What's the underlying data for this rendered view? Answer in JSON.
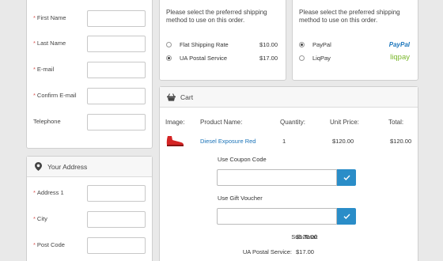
{
  "personal": {
    "fields": [
      {
        "label": "First Name",
        "required": true
      },
      {
        "label": "Last Name",
        "required": true
      },
      {
        "label": "E-mail",
        "required": true
      },
      {
        "label": "Confirm E-mail",
        "required": true
      },
      {
        "label": "Telephone",
        "required": false
      }
    ]
  },
  "address": {
    "title": "Your Address",
    "fields": [
      {
        "label": "Address 1",
        "required": true
      },
      {
        "label": "City",
        "required": true
      },
      {
        "label": "Post Code",
        "required": true
      }
    ]
  },
  "shipping": {
    "intro": "Please select the preferred shipping method to use on this order.",
    "options": [
      {
        "label": "Flat Shipping Rate",
        "price": "$10.00",
        "selected": false
      },
      {
        "label": "UA Postal Service",
        "price": "$17.00",
        "selected": true
      }
    ]
  },
  "payment": {
    "intro": "Please select the preferred shipping method to use on this order.",
    "options": [
      {
        "label": "PayPal",
        "logo": "PayPal",
        "logo_color": "#1b75bb",
        "selected": true
      },
      {
        "label": "LiqPay",
        "logo": "liqpay",
        "logo_color": "#7ab72b",
        "selected": false
      }
    ]
  },
  "cart": {
    "title": "Cart",
    "columns": [
      "Image:",
      "Product Name:",
      "Quantity:",
      "Unit Price:",
      "Total:"
    ],
    "rows": [
      {
        "name": "Diesel Exposure Red",
        "quantity": "1",
        "unit_price": "$120.00",
        "total": "$120.00"
      }
    ],
    "coupon_label": "Use Coupon Code",
    "voucher_label": "Use Gift Voucher",
    "totals": [
      {
        "label": "Sub-Total:",
        "value": "$120.00"
      },
      {
        "label": "UA Postal Service:",
        "value": "$17.00"
      }
    ]
  },
  "colors": {
    "accent": "#2a8dc8",
    "link": "#1a73b8",
    "required": "#d9534f"
  }
}
